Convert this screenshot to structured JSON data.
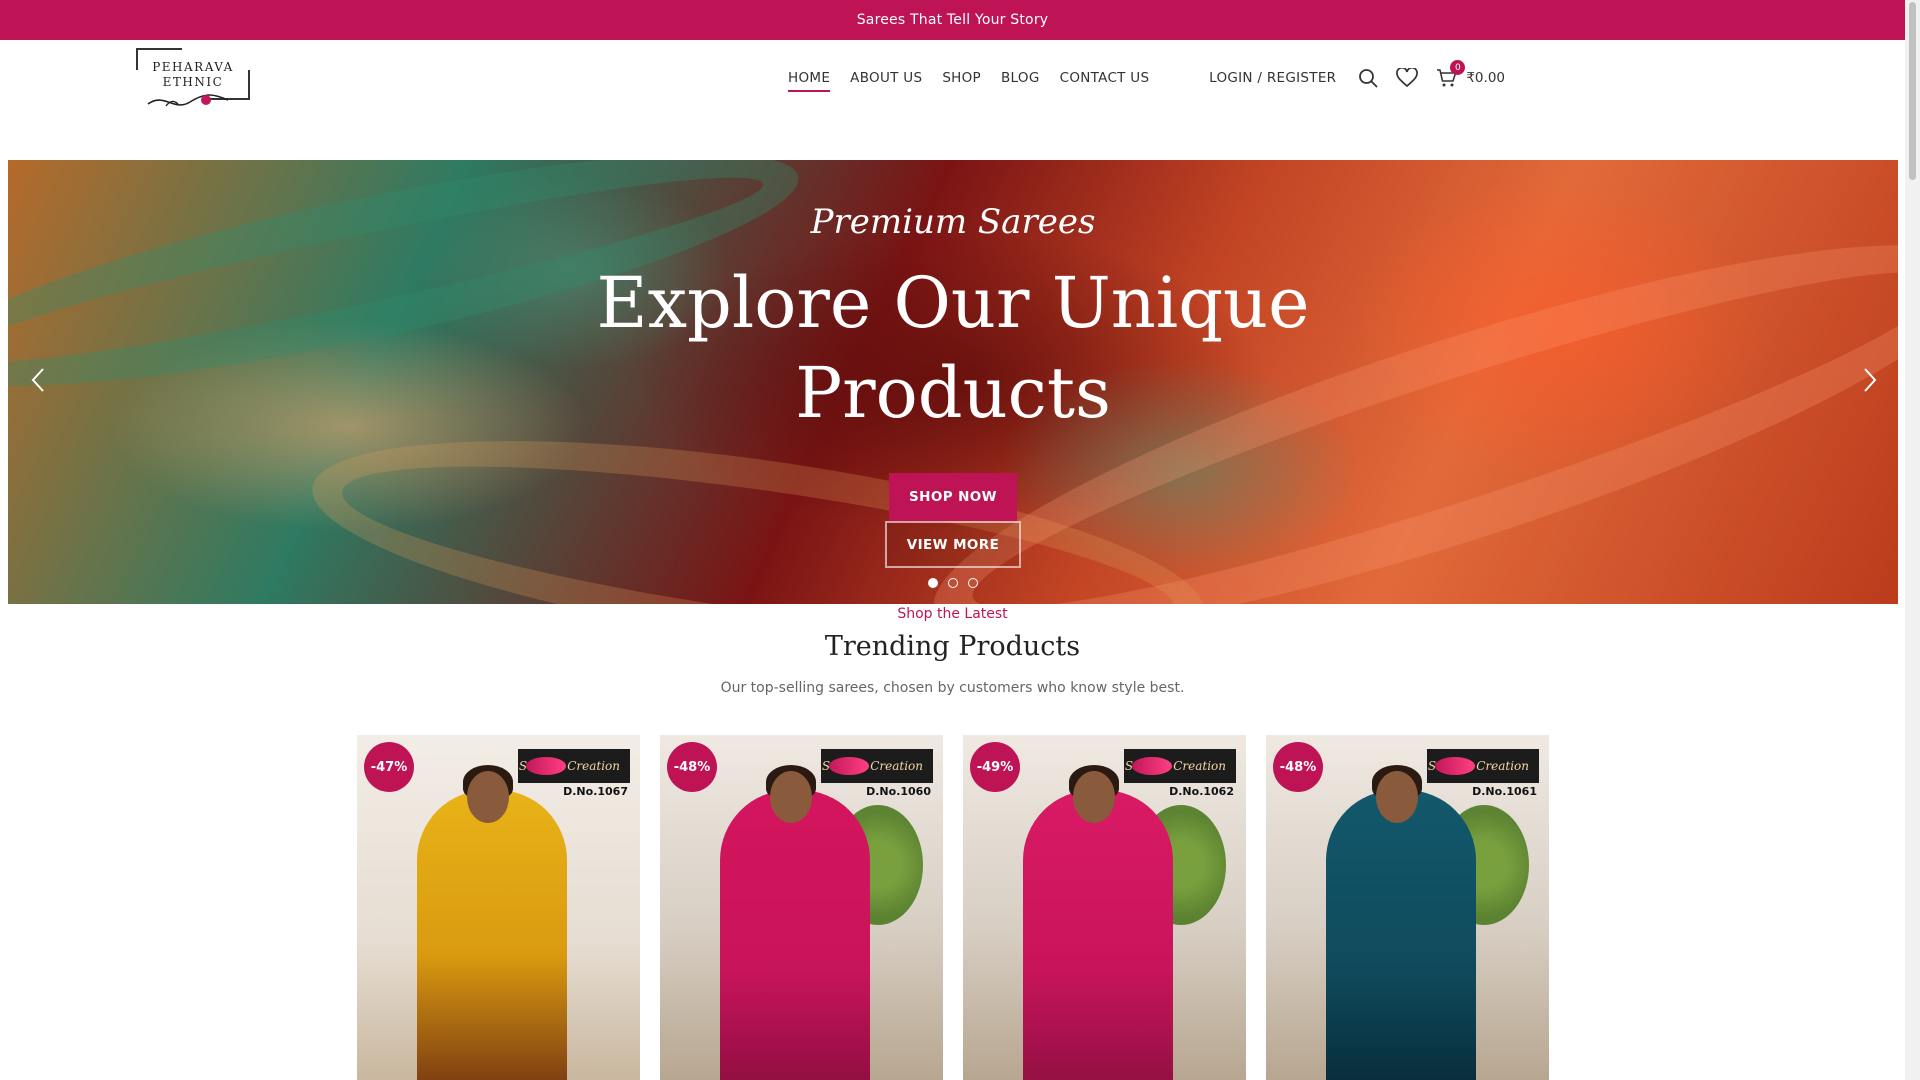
{
  "topbar": {
    "text": "Sarees That Tell Your Story"
  },
  "logo": {
    "line1": "PEHARAVA",
    "line2": "ETHNIC"
  },
  "nav": {
    "items": [
      {
        "label": "HOME"
      },
      {
        "label": "ABOUT US"
      },
      {
        "label": "SHOP"
      },
      {
        "label": "BLOG"
      },
      {
        "label": "CONTACT US"
      }
    ],
    "active_index": 0
  },
  "header": {
    "login_label": "LOGIN / REGISTER",
    "cart_count": "0",
    "cart_total": "₹0.00",
    "icons": [
      "search-icon",
      "heart-icon",
      "cart-icon"
    ]
  },
  "hero": {
    "subtitle": "Premium Sarees",
    "title": "Explore Our Unique Products",
    "shop_button": "SHOP NOW",
    "view_button": "VIEW MORE",
    "slide_count": 3,
    "active_slide": 0
  },
  "section": {
    "eyebrow": "Shop the Latest",
    "title": "Trending Products",
    "description": "Our top-selling sarees, chosen by customers who know style best."
  },
  "products": [
    {
      "discount": "-47%",
      "brand": "Saffron Creation",
      "design_no": "D.No.1067",
      "color": "#e8b318"
    },
    {
      "discount": "-48%",
      "brand": "Saffron Creation",
      "design_no": "D.No.1060",
      "color": "#c8145a"
    },
    {
      "discount": "-49%",
      "brand": "Saffron Creation",
      "design_no": "D.No.1062",
      "color": "#c8145a"
    },
    {
      "discount": "-48%",
      "brand": "Saffron Creation",
      "design_no": "D.No.1061",
      "color": "#0f4a5c"
    }
  ],
  "colors": {
    "accent": "#be1455",
    "text": "#333333"
  }
}
